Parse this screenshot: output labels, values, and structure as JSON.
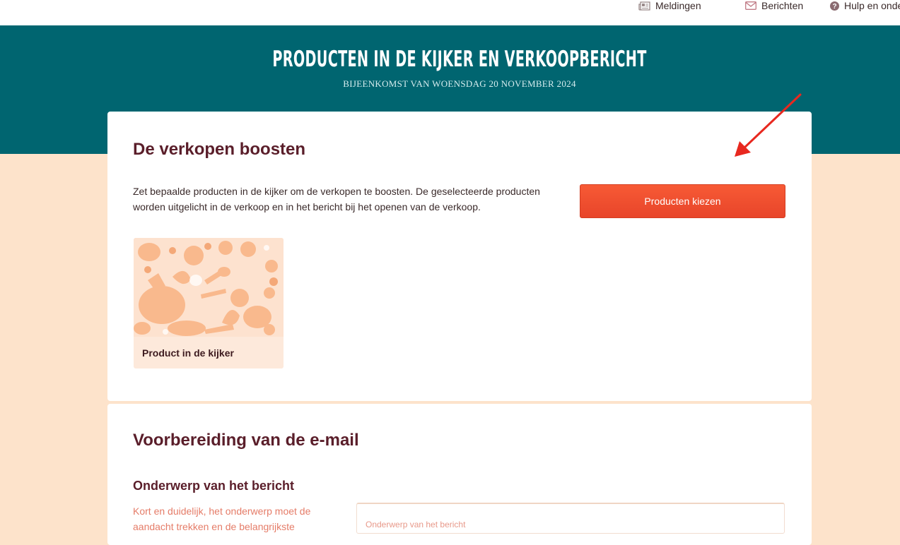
{
  "topnav": {
    "notifications_label": "Meldingen",
    "messages_label": "Berichten",
    "help_label": "Hulp en onde"
  },
  "header": {
    "title": "PRODUCTEN IN DE KIJKER EN VERKOOPBERICHT",
    "subtitle": "BIJEENKOMST VAN WOENSDAG 20 NOVEMBER 2024"
  },
  "boost_section": {
    "title": "De verkopen boosten",
    "description": "Zet bepaalde producten in de kijker om de verkopen te boosten. De geselecteerde producten worden uitgelicht in de verkoop en in het bericht bij het openen van de verkoop.",
    "choose_button": "Producten kiezen",
    "product_card_label": "Product in de kijker"
  },
  "email_section": {
    "title": "Voorbereiding van de e-mail",
    "subject_heading": "Onderwerp van het bericht",
    "subject_help": "Kort en duidelijk, het onderwerp moet de aandacht trekken en de belangrijkste",
    "subject_placeholder": "Onderwerp van het bericht"
  },
  "colors": {
    "accent": "#006570",
    "primary_button": "#f4532f",
    "heading": "#5a1e2a",
    "page_background": "#fde3cb",
    "annotation_arrow": "#e8281f"
  }
}
